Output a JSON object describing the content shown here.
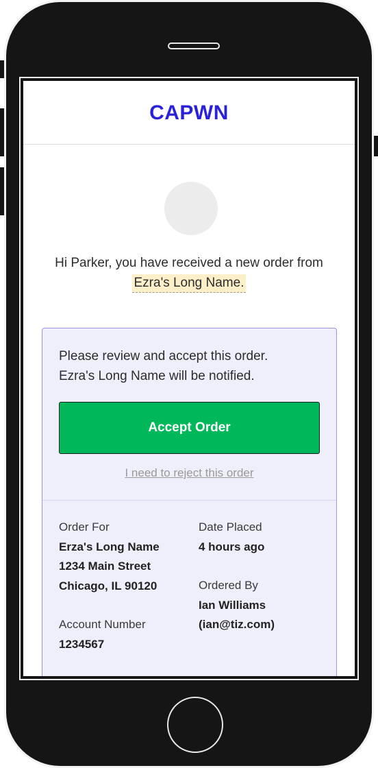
{
  "header": {
    "brand": "CAPWN"
  },
  "greeting": {
    "text": "Hi Parker, you have received a new order from",
    "sender": "Ezra's Long Name."
  },
  "order_card": {
    "review_line1": "Please review and accept this order.",
    "review_line2": "Ezra's Long Name will be notified.",
    "accept_label": "Accept Order",
    "reject_label": "I need to reject this order",
    "details": {
      "order_for_label": "Order For",
      "order_for_name": "Erza's Long Name",
      "order_for_street": "1234 Main Street",
      "order_for_city": "Chicago, IL 90120",
      "date_placed_label": "Date Placed",
      "date_placed_value": "4 hours ago",
      "ordered_by_label": "Ordered By",
      "ordered_by_name": "Ian Williams",
      "ordered_by_email": "(ian@tiz.com)",
      "account_label": "Account Number",
      "account_value": "1234567"
    }
  }
}
